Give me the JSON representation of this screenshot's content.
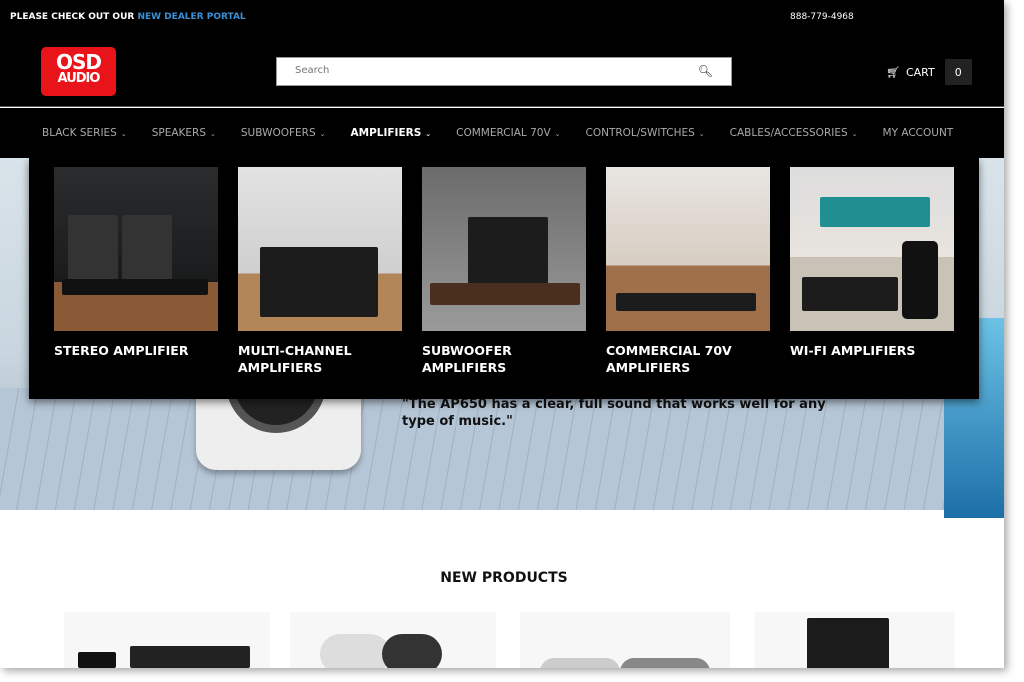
{
  "topbar": {
    "message": "PLEASE CHECK OUT OUR ",
    "link": "NEW DEALER PORTAL",
    "phone": "888-779-4968",
    "link_color": "#3a8fd6"
  },
  "header": {
    "logo": "OSD AUDIO",
    "logo_top": "OSD",
    "logo_bottom": "AUDIO",
    "search_placeholder": "Search",
    "cart_label": "CART",
    "cart_count": "0",
    "brand_color": "#e8141a"
  },
  "nav": {
    "items": [
      {
        "label": "BLACK SERIES"
      },
      {
        "label": "SPEAKERS"
      },
      {
        "label": "SUBWOOFERS"
      },
      {
        "label": "AMPLIFIERS",
        "active": true
      },
      {
        "label": "COMMERCIAL 70V"
      },
      {
        "label": "CONTROL/SWITCHES"
      },
      {
        "label": "CABLES/ACCESSORIES"
      },
      {
        "label": "MY ACCOUNT"
      }
    ]
  },
  "mega_menu": {
    "items": [
      {
        "label": "STEREO AMPLIFIER"
      },
      {
        "label": "MULTI-CHANNEL AMPLIFIERS"
      },
      {
        "label": "SUBWOOFER AMPLIFIERS"
      },
      {
        "label": "COMMERCIAL 70V AMPLIFIERS"
      },
      {
        "label": "WI-FI AMPLIFIERS"
      }
    ]
  },
  "hero": {
    "quote": "\"The AP650 has a clear, full sound that works well for any type of music.\""
  },
  "new_products": {
    "title": "NEW PRODUCTS"
  }
}
